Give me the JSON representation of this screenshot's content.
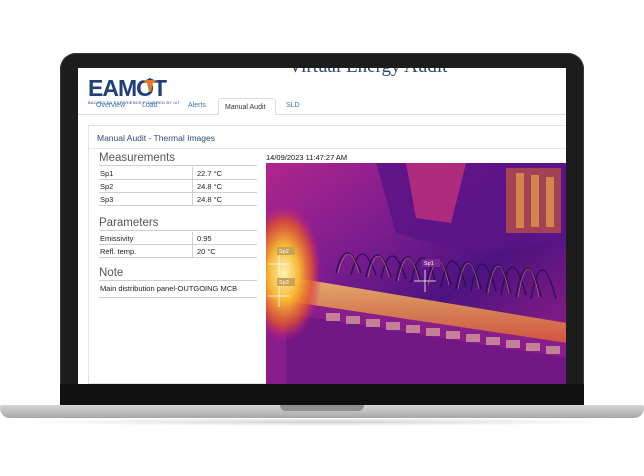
{
  "app": {
    "title": "Virtual Energy Audit",
    "logo_text": "EAMOT",
    "logo_tagline": "BACKED BY EXPERIENCE POWERED BY IoT"
  },
  "tabs": [
    {
      "label": "Overview",
      "active": false
    },
    {
      "label": "Load",
      "active": false
    },
    {
      "label": "Alerts",
      "active": false
    },
    {
      "label": "Manual Audit",
      "active": true
    },
    {
      "label": "SLD",
      "active": false
    }
  ],
  "panel": {
    "title": "Manual Audit - Thermal Images"
  },
  "measurements": {
    "heading": "Measurements",
    "rows": [
      {
        "label": "Sp1",
        "value": "22.7 °C"
      },
      {
        "label": "Sp2",
        "value": "24.8 °C"
      },
      {
        "label": "Sp3",
        "value": "24.8 °C"
      }
    ]
  },
  "parameters": {
    "heading": "Parameters",
    "rows": [
      {
        "label": "Emissivity",
        "value": "0.95"
      },
      {
        "label": "Refl. temp.",
        "value": "20  °C"
      }
    ]
  },
  "note": {
    "heading": "Note",
    "text": "Main distribution panel-OUTGOING MCB"
  },
  "thermal_image": {
    "timestamp": "14/09/2023 11:47:27 AM",
    "spots": [
      "Sp1",
      "Sp2",
      "Sp3"
    ]
  },
  "colors": {
    "brand": "#1f3f78",
    "link": "#3a76b8",
    "panel_title": "#2d4d73",
    "thermal_dark": "#3b0a6e",
    "thermal_mid": "#c2168a",
    "thermal_hot": "#f7b733",
    "thermal_white": "#fff3b0"
  }
}
